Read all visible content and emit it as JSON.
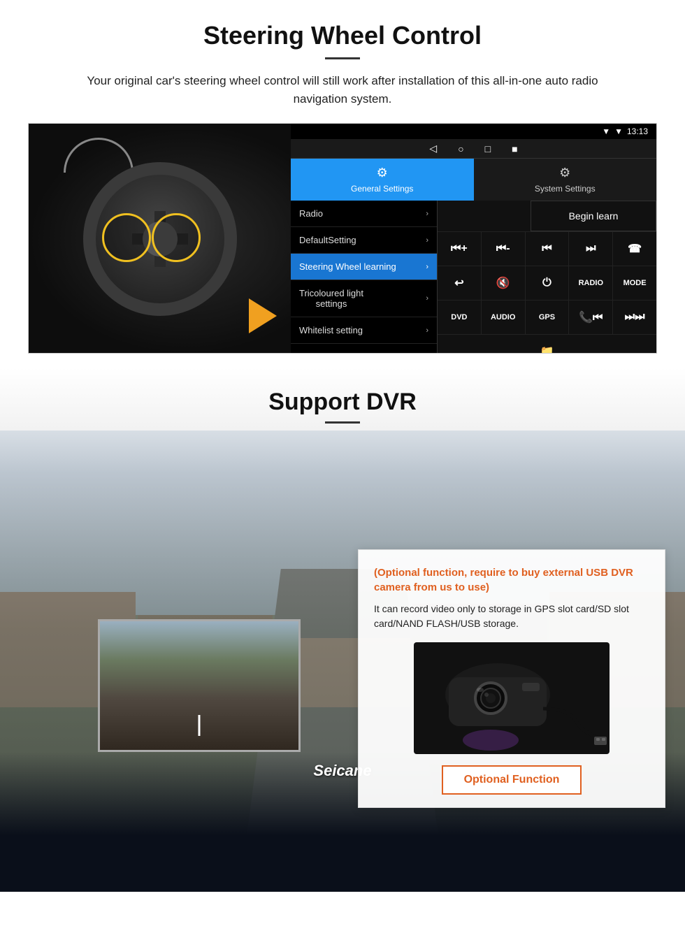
{
  "page": {
    "steering": {
      "title": "Steering Wheel Control",
      "description": "Your original car's steering wheel control will still work after installation of this all-in-one auto radio navigation system.",
      "android_ui": {
        "status_time": "13:13",
        "nav_items": [
          "◁",
          "○",
          "□",
          "■"
        ],
        "tabs": [
          {
            "label": "General Settings",
            "icon": "⚙",
            "active": true
          },
          {
            "label": "System Settings",
            "icon": "⚙",
            "active": false
          }
        ],
        "menu_items": [
          {
            "label": "Radio",
            "active": false
          },
          {
            "label": "DefaultSetting",
            "active": false
          },
          {
            "label": "Steering Wheel learning",
            "active": true
          },
          {
            "label": "Tricoloured light settings",
            "active": false
          },
          {
            "label": "Whitelist setting",
            "active": false
          }
        ],
        "begin_learn_label": "Begin learn",
        "control_buttons": [
          [
            "⏮+",
            "⏮-",
            "⏮⏮",
            "⏭⏭",
            "☎"
          ],
          [
            "↩",
            "🔇",
            "⏻",
            "RADIO",
            "MODE"
          ],
          [
            "DVD",
            "AUDIO",
            "GPS",
            "📞⏮",
            "⏭⏭"
          ]
        ]
      }
    },
    "dvr": {
      "title": "Support DVR",
      "info_title": "(Optional function, require to buy external USB DVR camera from us to use)",
      "info_desc": "It can record video only to storage in GPS slot card/SD slot card/NAND FLASH/USB storage.",
      "optional_button_label": "Optional Function"
    },
    "brand": "Seicane"
  }
}
